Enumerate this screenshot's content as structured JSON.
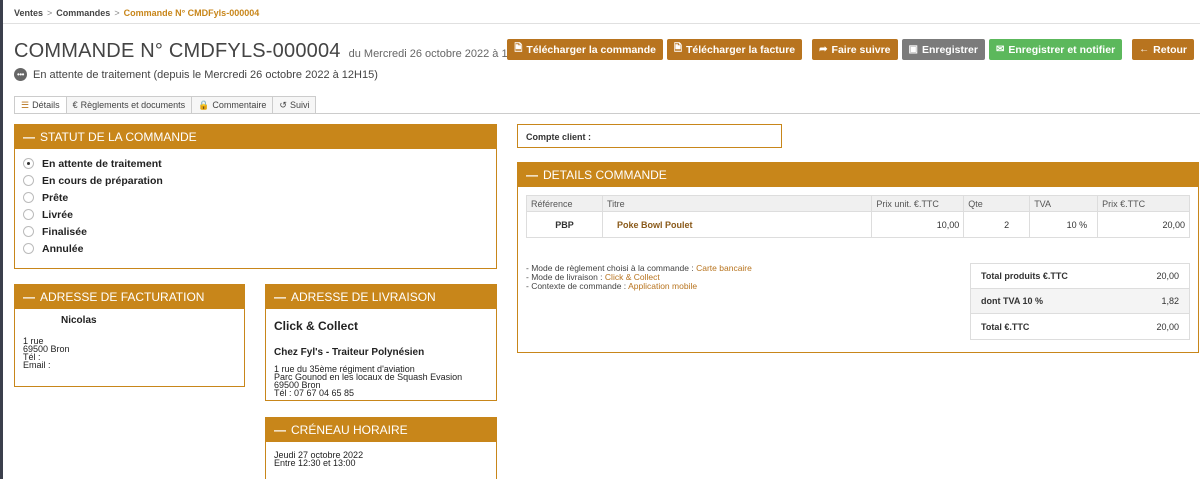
{
  "breadcrumb": {
    "items": [
      "Ventes",
      "Commandes"
    ],
    "current": "Commande N° CMDFyls-000004",
    "separator": ">"
  },
  "header": {
    "title": "COMMANDE N° CMDFYLS-000004",
    "date": "du Mercredi 26 octobre 2022 à 12H15",
    "status": "En attente de traitement (depuis le Mercredi 26 octobre 2022 à 12H15)",
    "status_icon_text": "•••"
  },
  "toolbar": {
    "download_order": "Télécharger la commande",
    "download_invoice": "Télécharger la facture",
    "forward": "Faire suivre",
    "save": "Enregistrer",
    "save_notify": "Enregistrer et notifier",
    "back": "Retour"
  },
  "tabs": {
    "details": "Détails",
    "payments": "Règlements et documents",
    "comment": "Commentaire",
    "tracking": "Suivi"
  },
  "statut": {
    "title": "STATUT DE LA COMMANDE",
    "options": [
      "En attente de traitement",
      "En cours de préparation",
      "Prête",
      "Livrée",
      "Finalisée",
      "Annulée"
    ],
    "selected": "En attente de traitement"
  },
  "billing": {
    "title": "ADRESSE DE FACTURATION",
    "name": "Nicolas",
    "street": "1 rue",
    "city": "69500 Bron",
    "tel": "Tél :",
    "email": "Email :"
  },
  "delivery": {
    "title": "ADRESSE DE LIVRAISON",
    "mode": "Click & Collect",
    "place": "Chez Fyl's - Traiteur Polynésien",
    "line1": "1 rue du 35ème régiment d'aviation",
    "line2": "Parc Gounod en les locaux de Squash Evasion",
    "city": "69500 Bron",
    "tel": "Tél : 07 67 04 65 85"
  },
  "slot": {
    "title": "CRÉNEAU HORAIRE",
    "date": "Jeudi 27 octobre 2022",
    "time": "Entre 12:30 et 13:00"
  },
  "account": {
    "label": "Compte client :"
  },
  "details": {
    "title": "DETAILS COMMANDE",
    "columns": {
      "ref": "Référence",
      "title": "Titre",
      "unit": "Prix unit. €.TTC",
      "qty": "Qte",
      "tva": "TVA",
      "price": "Prix €.TTC"
    },
    "rows": [
      {
        "ref": "PBP",
        "title": "Poke Bowl Poulet",
        "unit": "10,00",
        "qty": "2",
        "tva": "10 %",
        "price": "20,00"
      }
    ],
    "payment_label": "- Mode de règlement choisi à la commande :",
    "payment_value": "Carte bancaire",
    "delivery_label": "- Mode de livraison :",
    "delivery_value": "Click & Collect",
    "context_label": "- Contexte de commande :",
    "context_value": "Application mobile",
    "totals": {
      "products_label": "Total produits €.TTC",
      "products_value": "20,00",
      "tva_label": "dont TVA 10 %",
      "tva_value": "1,82",
      "total_label": "Total €.TTC",
      "total_value": "20,00"
    }
  },
  "colors": {
    "accent": "#c8861a",
    "button_brown": "#b8741f",
    "button_grey": "#7b7b7b",
    "button_green": "#5cb85c"
  }
}
